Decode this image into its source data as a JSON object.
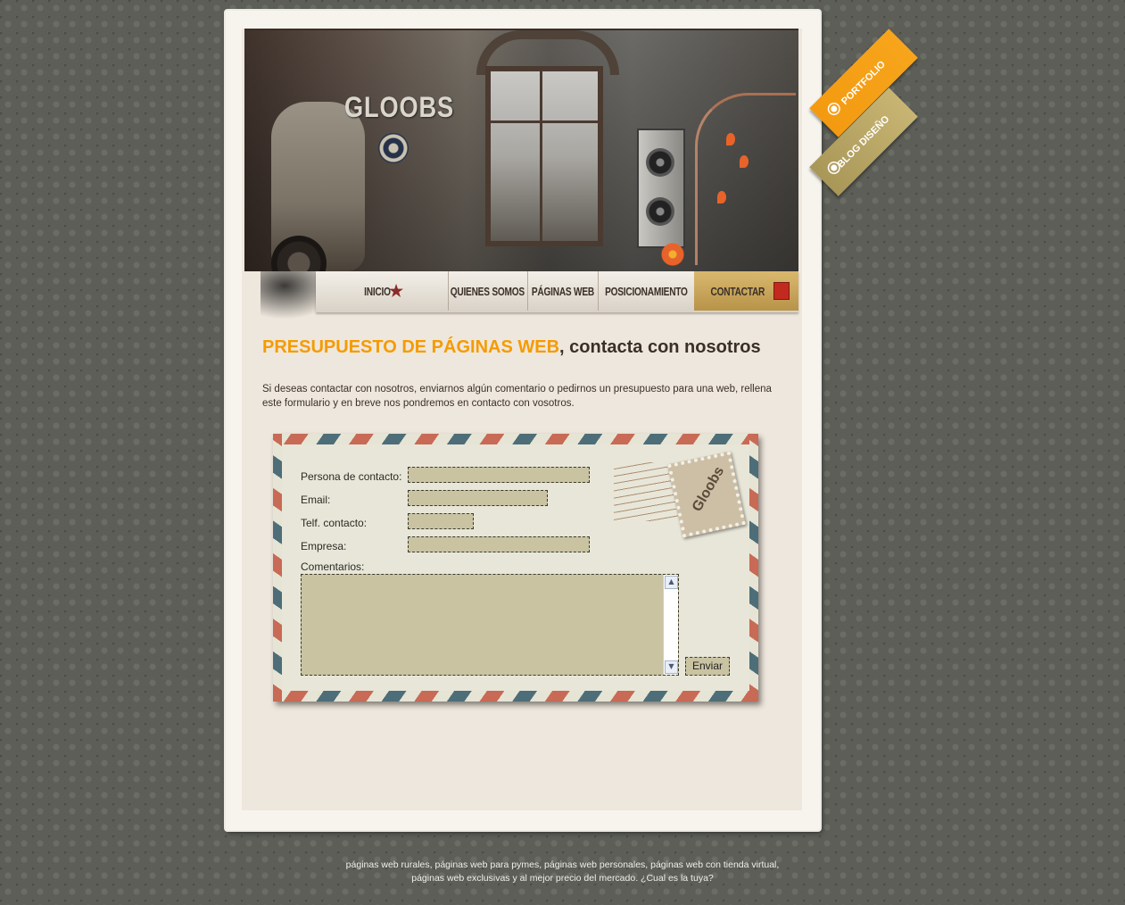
{
  "header": {
    "logo_text": "GLOOBS"
  },
  "nav": {
    "items": [
      {
        "label": "INICIO"
      },
      {
        "label": "QUIENES SOMOS"
      },
      {
        "label": "PÁGINAS WEB"
      },
      {
        "label": "POSICIONAMIENTO"
      },
      {
        "label": "CONTACTAR"
      }
    ]
  },
  "ribbons": {
    "portfolio": "PORTFOLIO",
    "blog": "BLOG DISEÑO"
  },
  "main": {
    "heading_highlight": "PRESUPUESTO DE PÁGINAS WEB",
    "heading_rest": ", contacta con nosotros",
    "intro": "Si deseas contactar con nosotros, enviarnos algún comentario o pedirnos un presupuesto para una web, rellena este formulario y en breve nos pondremos en contacto con vosotros."
  },
  "form": {
    "contact_label": "Persona de contacto:",
    "contact_value": "",
    "email_label": "Email:",
    "email_value": "",
    "phone_label": "Telf. contacto:",
    "phone_value": "",
    "company_label": "Empresa:",
    "company_value": "",
    "comments_label": "Comentarios:",
    "comments_value": "",
    "submit_label": "Enviar",
    "stamp_text": "Gloobs"
  },
  "footer": {
    "line1": "páginas web rurales, páginas web para pymes, páginas web personales, páginas web con tienda virtual,",
    "line2": "páginas web exclusivas y al mejor precio del mercado. ¿Cual es la tuya?"
  },
  "colors": {
    "accent": "#f59b00",
    "background": "#5c5e57",
    "field_fill": "#c9c3a2"
  }
}
